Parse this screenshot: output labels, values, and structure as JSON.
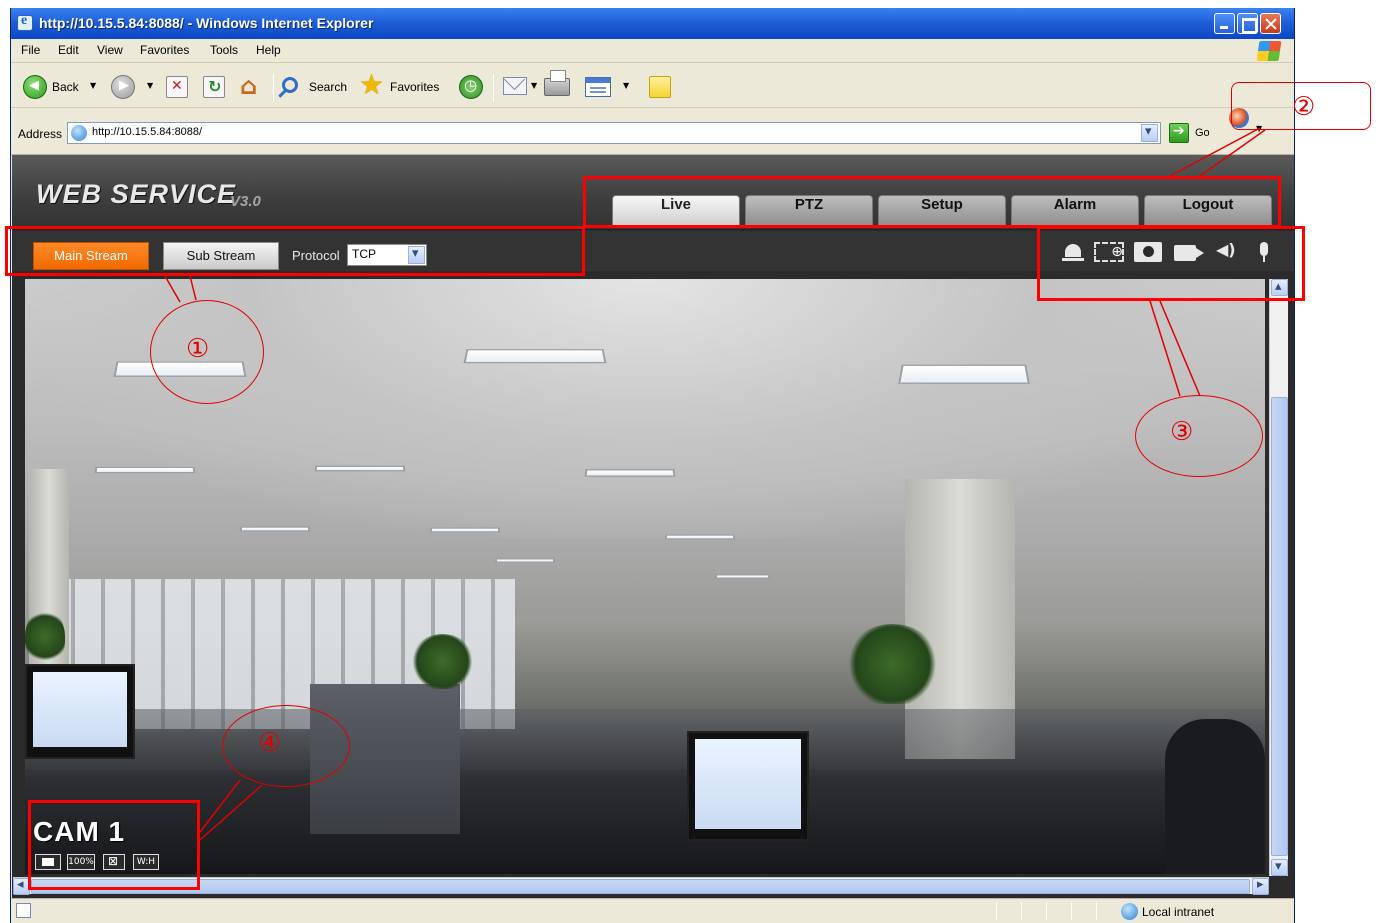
{
  "window": {
    "title": "http://10.15.5.84:8088/ - Windows Internet Explorer"
  },
  "menubar": {
    "items": [
      "File",
      "Edit",
      "View",
      "Favorites",
      "Tools",
      "Help"
    ]
  },
  "toolbar": {
    "back_label": "Back",
    "search_label": "Search",
    "favorites_label": "Favorites"
  },
  "addressbar": {
    "label": "Address",
    "url": "http://10.15.5.84:8088/",
    "go_label": "Go"
  },
  "webservice": {
    "logo": "WEB  SERVICE",
    "version": "V3.0",
    "nav_tabs": [
      "Live",
      "PTZ",
      "Setup",
      "Alarm",
      "Logout"
    ],
    "active_tab": "Live",
    "main_stream_label": "Main Stream",
    "sub_stream_label": "Sub Stream",
    "protocol_label": "Protocol",
    "protocol_value": "TCP"
  },
  "video": {
    "camera_title": "CAM 1",
    "overlay_buttons": [
      "100%",
      "W:H"
    ]
  },
  "statusbar": {
    "zone": "Local intranet"
  },
  "annotations": {
    "numbers": [
      "①",
      "②",
      "③",
      "④"
    ],
    "color": "#ff0000"
  },
  "colors": {
    "accent_orange": "#f06a00",
    "xp_title_blue": "#1f5fd6",
    "page_bg": "#2b2b2b"
  }
}
